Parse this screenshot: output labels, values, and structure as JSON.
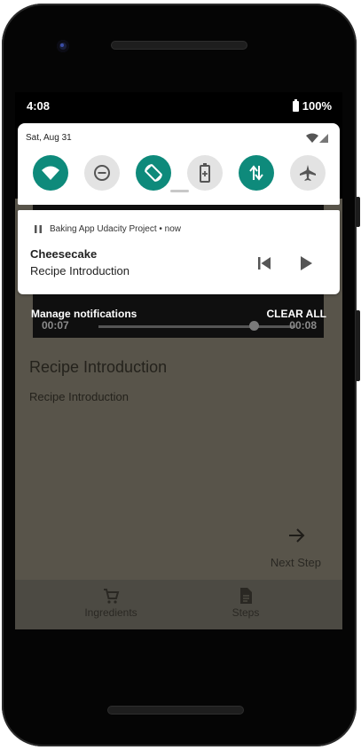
{
  "status_bar": {
    "time": "4:08",
    "battery": "100%"
  },
  "quick_settings": {
    "date": "Sat, Aug 31",
    "tiles": [
      {
        "name": "wifi",
        "state": "on"
      },
      {
        "name": "do-not-disturb",
        "state": "off"
      },
      {
        "name": "auto-rotate",
        "state": "on"
      },
      {
        "name": "battery-saver",
        "state": "off"
      },
      {
        "name": "mobile-data",
        "state": "on"
      },
      {
        "name": "airplane-mode",
        "state": "off"
      }
    ],
    "accent_color": "#0e8a7b"
  },
  "notification": {
    "app_line": "Baking App Udacity Project • now",
    "title": "Cheesecake",
    "text": "Recipe Introduction"
  },
  "shade_actions": {
    "manage": "Manage notifications",
    "clear_all": "CLEAR ALL"
  },
  "app": {
    "video": {
      "position": "00:07",
      "duration": "00:08"
    },
    "step_title": "Recipe Introduction",
    "step_description": "Recipe Introduction",
    "next_label": "Next Step",
    "bottom_nav": [
      {
        "label": "Ingredients",
        "icon": "cart-icon"
      },
      {
        "label": "Steps",
        "icon": "document-icon"
      }
    ]
  }
}
